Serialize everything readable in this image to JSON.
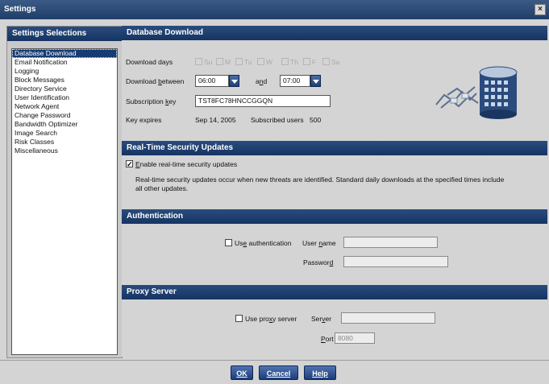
{
  "window": {
    "title": "Settings",
    "close": "×"
  },
  "sidebar": {
    "header": "Settings Selections",
    "items": [
      {
        "label": "Database Download"
      },
      {
        "label": "Email Notification"
      },
      {
        "label": "Logging"
      },
      {
        "label": "Block Messages"
      },
      {
        "label": "Directory Service"
      },
      {
        "label": "User Identification"
      },
      {
        "label": "Network Agent"
      },
      {
        "label": "Change Password"
      },
      {
        "label": "Bandwidth Optimizer"
      },
      {
        "label": "Image Search"
      },
      {
        "label": "Risk Classes"
      },
      {
        "label": "Miscellaneous"
      }
    ],
    "selected": "Database Download"
  },
  "database_download": {
    "header": "Database Download",
    "days_label": "Download days",
    "days": [
      "Su",
      "M",
      "Tu",
      "W",
      "Th",
      "F",
      "Sa"
    ],
    "between_label": "Download between",
    "start_time": "06:00",
    "and_label": "and",
    "end_time": "07:00",
    "key_label": "Subscription key",
    "key_value": "TST8FC78HNCCGGQN",
    "expires_label": "Key expires",
    "expires_value": "Sep 14, 2005",
    "users_label": "Subscribed users",
    "users_value": "500"
  },
  "realtime": {
    "header": "Real-Time Security Updates",
    "checkbox_label": "Enable real-time security updates",
    "checked": true,
    "desc_line1": "Real-time security updates occur when new threats are identified.  Standard daily downloads at the specified times include",
    "desc_line2": "all other updates."
  },
  "auth": {
    "header": "Authentication",
    "checkbox_label": "Use authentication",
    "checked": false,
    "user_label": "User name",
    "user_value": "",
    "password_label": "Password",
    "password_value": ""
  },
  "proxy": {
    "header": "Proxy Server",
    "checkbox_label": "Use proxy server",
    "checked": false,
    "server_label": "Server",
    "server_value": "",
    "port_label": "Port",
    "port_value": "8080"
  },
  "buttons": {
    "ok": "OK",
    "cancel": "Cancel",
    "help": "Help"
  }
}
